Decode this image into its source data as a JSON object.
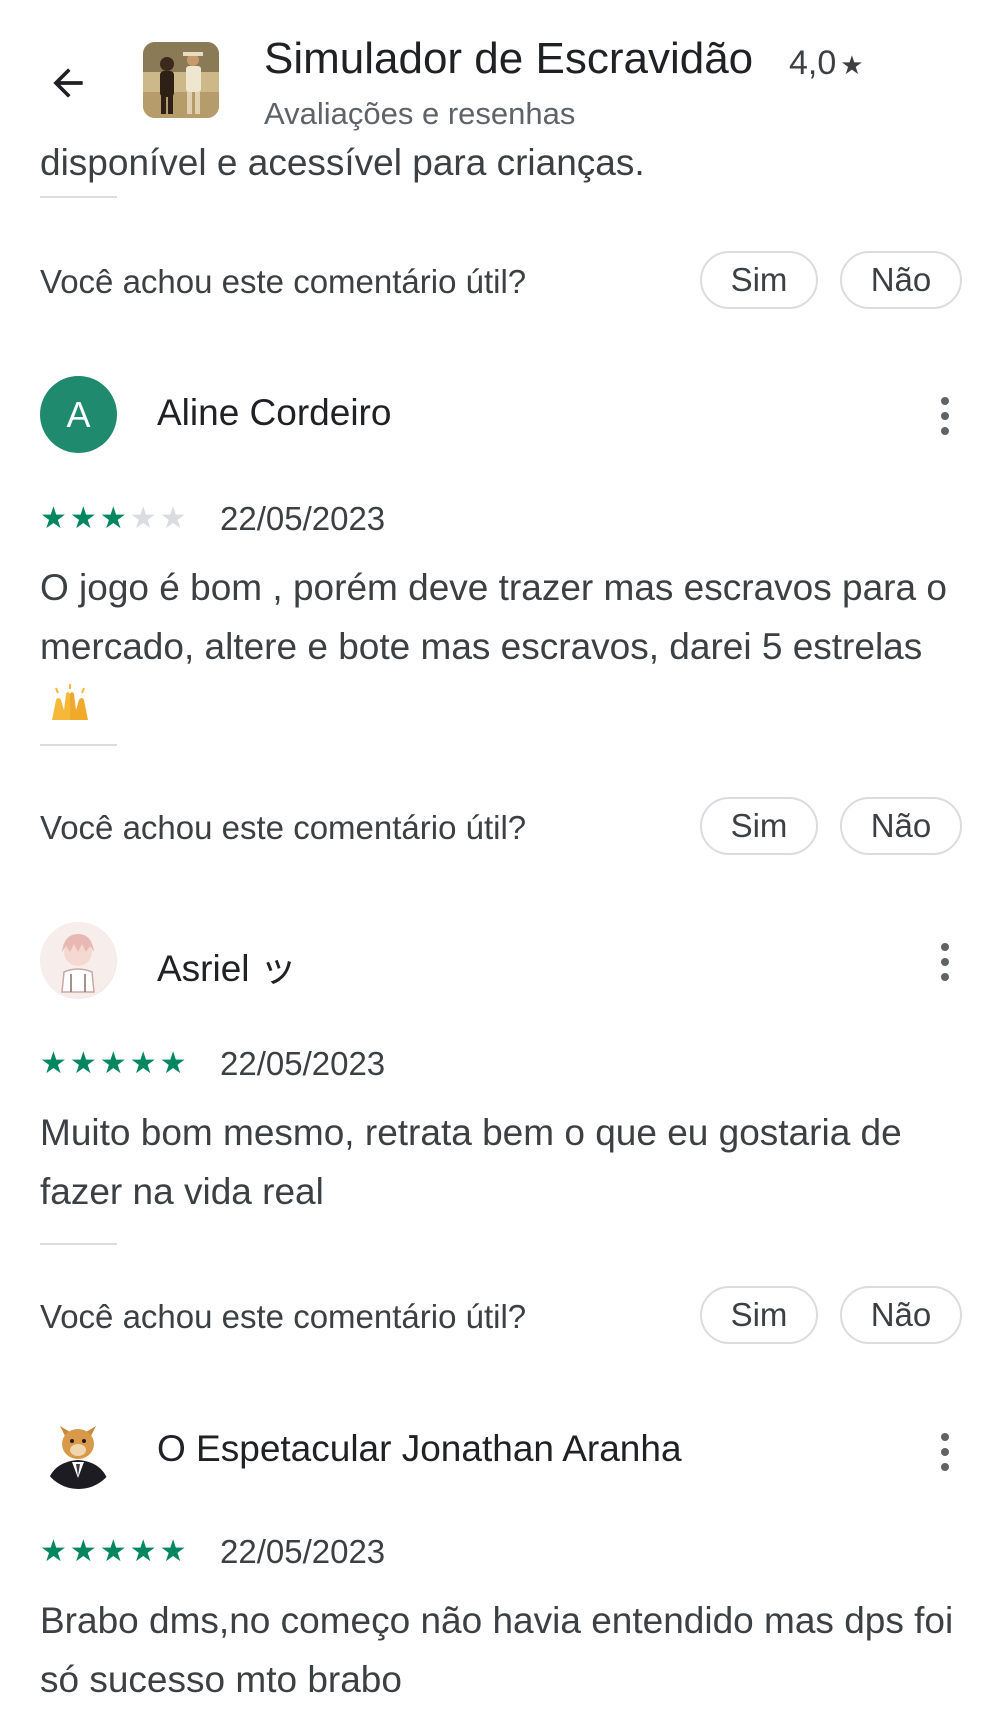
{
  "header": {
    "title": "Simulador de Escravidão",
    "rating": "4,0",
    "subtitle": "Avaliações e resenhas"
  },
  "previous_review": {
    "text_tail": "disponível e acessível para crianças."
  },
  "helpful": {
    "question": "Você achou este comentário útil?",
    "yes_label": "Sim",
    "no_label": "Não"
  },
  "reviews": [
    {
      "name": "Aline Cordeiro",
      "avatar_letter": "A",
      "stars": 3,
      "date": "22/05/2023",
      "text": "O jogo é bom , porém deve trazer mas escravos para o mercado, altere e bote mas escravos, darei 5 estrelas"
    },
    {
      "name": "Asriel ッ",
      "stars": 5,
      "date": "22/05/2023",
      "text": "Muito bom mesmo, retrata bem o que eu gostaria de fazer na vida real"
    },
    {
      "name": "O Espetacular Jonathan Aranha",
      "stars": 5,
      "date": "22/05/2023",
      "text": "Brabo dms,no começo não havia entendido mas dps foi só sucesso mto brabo"
    }
  ],
  "colors": {
    "star_filled": "#01875f",
    "star_empty": "#dadce0",
    "avatar_a": "#1f8a6e"
  },
  "icons": {
    "back": "arrow-left-icon",
    "more": "more-vert-icon",
    "emoji": "raising-hands-emoji"
  }
}
